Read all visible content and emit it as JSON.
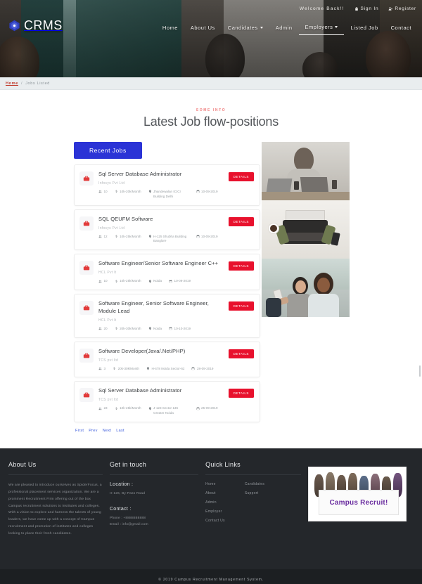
{
  "brand": {
    "name": "CRMS",
    "logo_icon": "crms-logo-icon"
  },
  "topbar": {
    "welcome": "Welcome Back!!",
    "sign_in": "Sign In",
    "sign_in_icon": "lock-icon",
    "register": "Register",
    "register_icon": "user-plus-icon"
  },
  "nav": {
    "items": [
      {
        "label": "Home",
        "has_caret": false,
        "active": false
      },
      {
        "label": "About Us",
        "has_caret": false,
        "active": false
      },
      {
        "label": "Candidates",
        "has_caret": true,
        "active": false
      },
      {
        "label": "Admin",
        "has_caret": false,
        "active": false
      },
      {
        "label": "Employers",
        "has_caret": true,
        "active": true
      },
      {
        "label": "Listed Job",
        "has_caret": false,
        "active": false
      },
      {
        "label": "Contact",
        "has_caret": false,
        "active": false
      }
    ]
  },
  "breadcrumb": {
    "home": "Home",
    "separator": "/",
    "current": "Jobs Listed"
  },
  "page": {
    "eyebrow": "SOME INFO",
    "title": "Latest Job flow-positions"
  },
  "jobs_panel": {
    "tab_label": "Recent Jobs",
    "details_label": "DETAILS",
    "icons": {
      "briefcase": "briefcase-icon",
      "openings": "people-icon",
      "salary": "dollar-icon",
      "location": "map-pin-icon",
      "date": "calendar-icon"
    },
    "jobs": [
      {
        "title": "Sql Server Database Administrator",
        "company": "Infosys Pvt Ltd",
        "openings": "10",
        "salary": "10k-20k/Month",
        "location": "Jhandewalan ICICI Building Delhi",
        "date": "10-09-2019"
      },
      {
        "title": "SQL QEUFM Software",
        "company": "Infosys Pvt Ltd",
        "openings": "12",
        "salary": "10k-25k/Month",
        "location": "H-125 Shubha Building Banglore",
        "date": "10-09-2019"
      },
      {
        "title": "Software Engineer/Senior Software Engineer C++",
        "company": "HCL Pvt lt",
        "openings": "10",
        "salary": "10k-25k/Month",
        "location": "Noida",
        "date": "10-09-2019"
      },
      {
        "title": "Software Engineer, Senior Software Engineer, Module Lead",
        "company": "HCL Pvt lt",
        "openings": "20",
        "salary": "20k-30k/Month",
        "location": "Noida",
        "date": "10-10-2019"
      },
      {
        "title": "Software Developer(Java/.Net/PHP)",
        "company": "TCS pvt ltd",
        "openings": "3",
        "salary": "20k-30k/Month",
        "location": "H-478 Noida Sector-62",
        "date": "28-09-2019"
      },
      {
        "title": "Sql Server Database Administrator",
        "company": "TCS pvt ltd",
        "openings": "23",
        "salary": "10k-25k/Month",
        "location": "J-123 Sector 136 Greater Noida",
        "date": "25-09-2019"
      }
    ],
    "pagination": [
      "First",
      "Prev",
      "Next",
      "Last"
    ]
  },
  "photos": [
    {
      "name": "woman-at-desk-with-laptops-photo"
    },
    {
      "name": "hands-with-typewriter-photo"
    },
    {
      "name": "two-women-taking-selfie-photo"
    }
  ],
  "footer": {
    "about": {
      "heading": "About Us",
      "text": "We are pleased to introduce ourselves as SpiderFocus, a professional placement services organization. We are a prominent Recruitment Firm offering out of the box Campus recruitment solutions to institutes and colleges. With a vision to explore and harness the talents of young leaders, we have come up with a concept of Campus recruitment and promotion of institutes and colleges looking to place their fresh candidates."
    },
    "touch": {
      "heading": "Get in touch",
      "location_label": "Location :",
      "location_value": "H-126, By-Pass Road",
      "contact_label": "Contact :",
      "phone": "Phone : +8888888888",
      "email": "Email : info@gmail.com"
    },
    "links": {
      "heading": "Quick Links",
      "col1": [
        "Home",
        "About",
        "Admin",
        "Employer",
        "Contact Us"
      ],
      "col2": [
        "Candidates",
        "Support"
      ]
    },
    "banner": {
      "text": "Campus Recruit!",
      "name": "campus-recruit-banner"
    },
    "copyright": "© 2019 Campus Recruitment Management System."
  }
}
